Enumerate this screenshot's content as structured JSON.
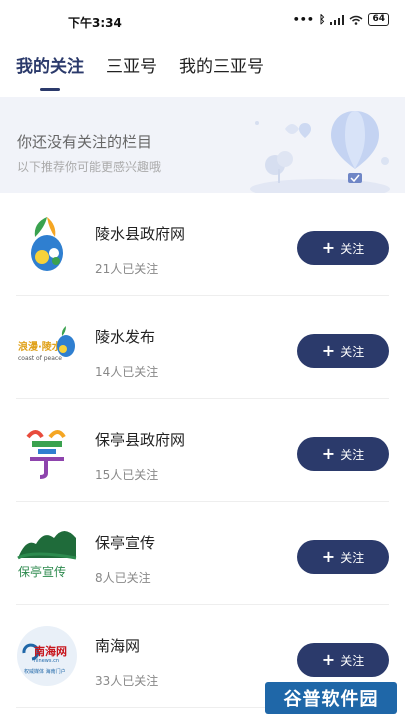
{
  "status_bar": {
    "time": "下午3:34",
    "signal_text": "•••",
    "battery": "64"
  },
  "tabs": [
    {
      "label": "我的关注",
      "active": true
    },
    {
      "label": "三亚号",
      "active": false
    },
    {
      "label": "我的三亚号",
      "active": false
    }
  ],
  "banner": {
    "title": "你还没有关注的栏目",
    "subtitle": "以下推荐你可能更感兴趣哦"
  },
  "follow_label": "关注",
  "items": [
    {
      "name": "陵水县政府网",
      "count": "21人已关注"
    },
    {
      "name": "陵水发布",
      "count": "14人已关注"
    },
    {
      "name": "保亭县政府网",
      "count": "15人已关注"
    },
    {
      "name": "保亭宣传",
      "count": "8人已关注"
    },
    {
      "name": "南海网",
      "count": "33人已关注"
    }
  ],
  "logo_texts": {
    "nanhai": "南海网",
    "nanhai_domain": "hinews.cn",
    "nanhai_tag": "权威媒体 海南门户"
  },
  "watermark": "谷普软件园",
  "colors": {
    "accent": "#2b3a6b",
    "banner_bg": "#f1f3f9"
  }
}
